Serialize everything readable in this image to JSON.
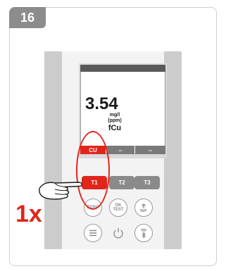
{
  "step": {
    "number": "16"
  },
  "display": {
    "value": "3.54",
    "unit_line1": "mg/l",
    "unit_line2": "(ppm)",
    "parameter": "fCu"
  },
  "softkeys": [
    "CU",
    "--",
    "--"
  ],
  "test_keys": [
    "T1",
    "T2",
    "T3"
  ],
  "buttons": {
    "zero": "ZERO",
    "ok_test_line1": "OK",
    "ok_test_line2": "TEST"
  },
  "instruction": {
    "press_count": "1x"
  },
  "colors": {
    "accent": "#e1251b",
    "gray_key": "#8a8a8a",
    "band": "#cccccc"
  },
  "icons": [
    "hand-pointer-icon",
    "upload-icon",
    "menu-icon",
    "power-icon",
    "bluetooth-wifi-icon"
  ]
}
